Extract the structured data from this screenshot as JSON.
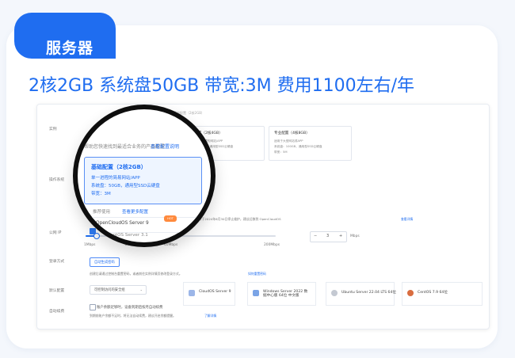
{
  "header": {
    "tab_label": "服务器",
    "headline": "2核2GB 系统盘50GB 带宽:3M 费用1100左右/年"
  },
  "panel": {
    "row_labels": {
      "plan": "实例",
      "os": "操作系统",
      "public_ip": "公网 IP",
      "login": "登录方式",
      "security": "默认配置",
      "renew": "自动续费"
    },
    "top_hint": "基础配置（2核2GB）",
    "plans": [
      {
        "title": "热门配置（2核4GB）",
        "lines": [
          "适用于中等规模的网站/APP",
          "系统盘：80GB，通用型SSD云硬盘",
          "带宽：3M"
        ]
      },
      {
        "title": "专业配置（4核8GB）",
        "lines": [
          "适用于大型网站或APP",
          "系统盘：100GB，通用型SSD云硬盘",
          "带宽：5M"
        ]
      }
    ],
    "zoom": {
      "intro": "帮助您快速找到最适合业务的产品配置",
      "link": "查看配置说明",
      "selected_title": "基础配置（2核2GB）",
      "selected_lines": [
        "单一进程的简易网站/APP",
        "系统盘：50GB，通用型SSD云硬盘",
        "带宽：3M"
      ],
      "recommend": "推荐使用",
      "recommend_link": "查看更多配置",
      "os_name": "OpenCloudOS Server 9",
      "os_sub": "CentOS Server 3.1"
    },
    "os_tiles": [
      {
        "name": "CloudOS Server 9"
      },
      {
        "name": "Windows Server 2022 数据中心版 64位 中文版"
      },
      {
        "name": "Ubuntu Server 22.04 LTS 64位"
      },
      {
        "name": "CentOS 7.9 64位",
        "selected": true
      }
    ],
    "os_note": "CentOS 7 将于2024年6月30日停止维护，建议迁移到 OpenCloudOS",
    "os_note_link": "查看详情",
    "bandwidth": {
      "checked": true,
      "ticks": [
        "1Mbps",
        "20Mbps",
        "40Mbps",
        "200Mbps"
      ],
      "value": "3",
      "unit": "Mbps",
      "minus": "−",
      "plus": "+"
    },
    "login_button": "自动生成密码",
    "login_hint": "创建后请通过控制台重置密码，或者前往实例详情页修改登录方式。",
    "login_link": "如何重置密码",
    "security_value": "可控制访问的安全组",
    "renew_text": "账户余额足够时，设备到期后按月自动续费",
    "renew_hint": "到期前账户余额不足时，将无法自动续费，建议开启余额提醒。",
    "renew_link": "了解详情"
  }
}
